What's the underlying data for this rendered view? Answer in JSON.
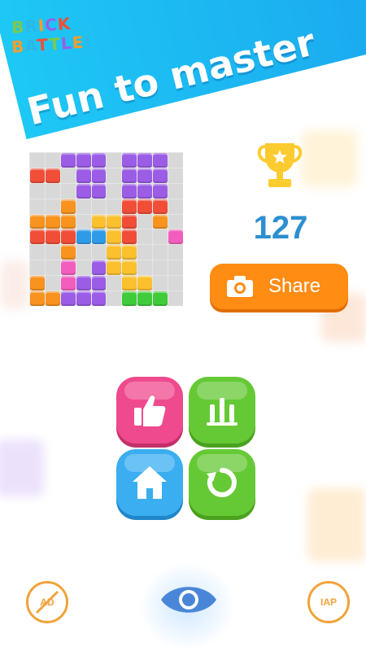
{
  "header": {
    "logo_line1": "BRICK",
    "logo_line2": "BATTLE!",
    "tagline": "Fun to master"
  },
  "score": {
    "value": "127"
  },
  "share": {
    "label": "Share"
  },
  "menu": {
    "like_icon": "thumbs-up-icon",
    "rank_icon": "leaderboard-icon",
    "home_icon": "home-icon",
    "restart_icon": "restart-icon"
  },
  "bottom": {
    "ad_label": "AD",
    "iap_label": "IAP",
    "eye_icon": "eye-icon"
  },
  "colors": {
    "band": "#1aa3ee",
    "share": "#ff8c13",
    "score": "#2c8fd1",
    "like": "#ef4a8d",
    "green": "#65c935",
    "home": "#3aaef0",
    "bottom_icons": "#f0a33a"
  },
  "board": {
    "palette": {
      "p": "#9b5de5",
      "o": "#f7931e",
      "r": "#f04e37",
      "y": "#fbc02d",
      "k": "#f25ebd",
      "b": "#2f9be8",
      "g": "#3fcb3a",
      ".": ""
    },
    "rows": [
      "..ppp.ppp.",
      "rr.pp.ppp.",
      "...pp.ppp.",
      "..o...rrr.",
      "ooo.yyr.o.",
      "rrrbbyr..k",
      "..o..yy...",
      "..k.pyy...",
      "o.kpp.yy..",
      "ooppp.ggg."
    ]
  }
}
